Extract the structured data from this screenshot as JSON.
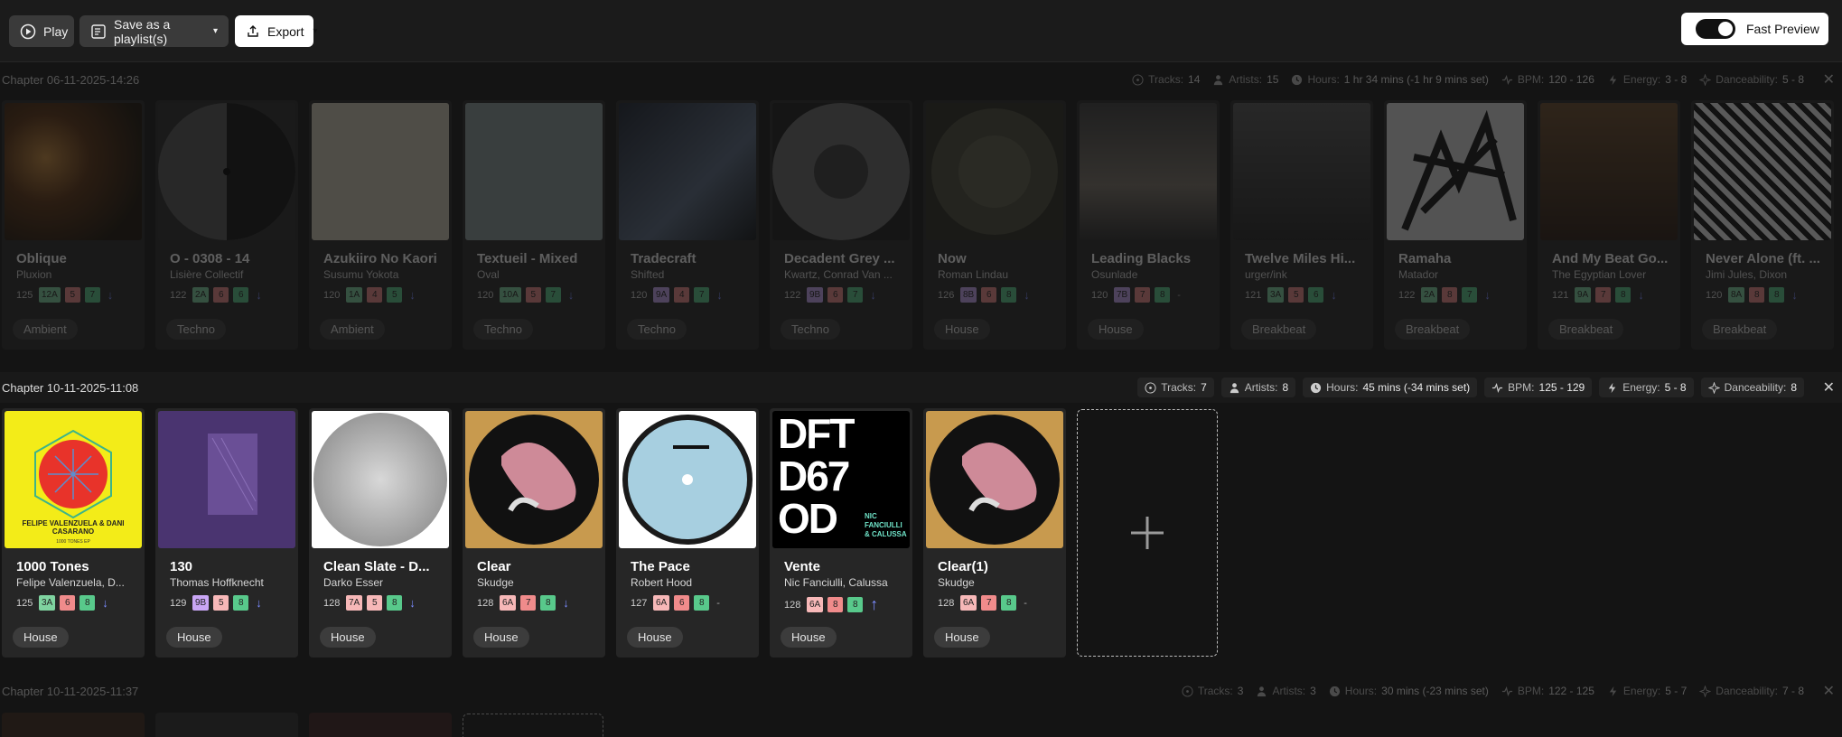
{
  "toolbar": {
    "play_label": "Play",
    "save_label": "Save as a playlist(s)",
    "export_label": "Export",
    "fast_preview_label": "Fast Preview"
  },
  "chapters": [
    {
      "title": "Chapter 06-11-2025-14:26",
      "stats": {
        "tracks_label": "Tracks:",
        "tracks": "14",
        "artists_label": "Artists:",
        "artists": "15",
        "hours_label": "Hours:",
        "hours": "1 hr 34 mins (-1 hr 9 mins set)",
        "bpm_label": "BPM:",
        "bpm": "120 - 126",
        "energy_label": "Energy:",
        "energy": "3 - 8",
        "dance_label": "Danceability:",
        "dance": "5 - 8"
      },
      "tracks": [
        {
          "title": "Oblique",
          "artist": "Pluxion",
          "bpm": "125",
          "key": "12A",
          "energy": "5",
          "dance": "7",
          "genre": "Ambient"
        },
        {
          "title": "O - 0308 - 14",
          "artist": "Lisière Collectif",
          "bpm": "122",
          "key": "2A",
          "energy": "6",
          "dance": "6",
          "genre": "Techno"
        },
        {
          "title": "Azukiiro No Kaori",
          "artist": "Susumu Yokota",
          "bpm": "120",
          "key": "1A",
          "energy": "4",
          "dance": "5",
          "genre": "Ambient"
        },
        {
          "title": "Textueil - Mixed",
          "artist": "Oval",
          "bpm": "120",
          "key": "10A",
          "energy": "5",
          "dance": "7",
          "genre": "Techno"
        },
        {
          "title": "Tradecraft",
          "artist": "Shifted",
          "bpm": "120",
          "key": "9A",
          "energy": "4",
          "dance": "7",
          "genre": "Techno"
        },
        {
          "title": "Decadent Grey ...",
          "artist": "Kwartz, Conrad Van ...",
          "bpm": "122",
          "key": "9B",
          "energy": "6",
          "dance": "7",
          "genre": "Techno"
        },
        {
          "title": "Now",
          "artist": "Roman Lindau",
          "bpm": "126",
          "key": "8B",
          "energy": "6",
          "dance": "8",
          "genre": "House"
        },
        {
          "title": "Leading Blacks",
          "artist": "Osunlade",
          "bpm": "120",
          "key": "7B",
          "energy": "7",
          "dance": "8",
          "genre": "House"
        },
        {
          "title": "Twelve Miles Hi...",
          "artist": "urger/ink",
          "bpm": "121",
          "key": "3A",
          "energy": "5",
          "dance": "6",
          "genre": "Breakbeat"
        },
        {
          "title": "Ramaha",
          "artist": "Matador",
          "bpm": "122",
          "key": "2A",
          "energy": "8",
          "dance": "7",
          "genre": "Breakbeat"
        },
        {
          "title": "And My Beat Go...",
          "artist": "The Egyptian Lover",
          "bpm": "121",
          "key": "9A",
          "energy": "7",
          "dance": "8",
          "genre": "Breakbeat"
        },
        {
          "title": "Never Alone (ft. ...",
          "artist": "Jimi Jules, Dixon",
          "bpm": "120",
          "key": "8A",
          "energy": "8",
          "dance": "8",
          "genre": "Breakbeat"
        }
      ]
    },
    {
      "title": "Chapter 10-11-2025-11:08",
      "stats": {
        "tracks_label": "Tracks:",
        "tracks": "7",
        "artists_label": "Artists:",
        "artists": "8",
        "hours_label": "Hours:",
        "hours": "45 mins (-34 mins set)",
        "bpm_label": "BPM:",
        "bpm": "125 - 129",
        "energy_label": "Energy:",
        "energy": "5 - 8",
        "dance_label": "Danceability:",
        "dance": "8"
      },
      "tracks": [
        {
          "title": "1000 Tones",
          "artist": "Felipe Valenzuela, D...",
          "bpm": "125",
          "key": "3A",
          "energy": "6",
          "dance": "8",
          "trend": "down",
          "genre": "House"
        },
        {
          "title": "130",
          "artist": "Thomas Hoffknecht",
          "bpm": "129",
          "key": "9B",
          "energy": "5",
          "dance": "8",
          "trend": "down",
          "genre": "House"
        },
        {
          "title": "Clean Slate - D...",
          "artist": "Darko Esser",
          "bpm": "128",
          "key": "7A",
          "energy": "5",
          "dance": "8",
          "trend": "down",
          "genre": "House"
        },
        {
          "title": "Clear",
          "artist": "Skudge",
          "bpm": "128",
          "key": "6A",
          "energy": "7",
          "dance": "8",
          "trend": "down",
          "genre": "House"
        },
        {
          "title": "The Pace",
          "artist": "Robert Hood",
          "bpm": "127",
          "key": "6A",
          "energy": "6",
          "dance": "8",
          "trend": "none",
          "genre": "House"
        },
        {
          "title": "Vente",
          "artist": "Nic Fanciulli, Calussa",
          "bpm": "128",
          "key": "6A",
          "energy": "8",
          "dance": "8",
          "trend": "up",
          "genre": "House"
        },
        {
          "title": "Clear(1)",
          "artist": "Skudge",
          "bpm": "128",
          "key": "6A",
          "energy": "7",
          "dance": "8",
          "trend": "none",
          "genre": "House"
        }
      ]
    },
    {
      "title": "Chapter 10-11-2025-11:37",
      "stats": {
        "tracks_label": "Tracks:",
        "tracks": "3",
        "artists_label": "Artists:",
        "artists": "3",
        "hours_label": "Hours:",
        "hours": "30 mins (-23 mins set)",
        "bpm_label": "BPM:",
        "bpm": "122 - 125",
        "energy_label": "Energy:",
        "energy": "5 - 7",
        "dance_label": "Danceability:",
        "dance": "7 - 8"
      }
    }
  ],
  "art_text": {
    "vente_big": "DFT D67 OD",
    "vente_credit": "NIC FANCIULLI & CALUSSA",
    "tones_credit": "FELIPE VALENZUELA & DANI CASARANO",
    "tones_label": "1000 TONES EP"
  },
  "colors": {
    "key_major": "#c9a6f5",
    "key_minor": "#7fd3a0",
    "energy": "#f08b8b",
    "dance": "#58c98b",
    "trend": "#7b8cff"
  }
}
